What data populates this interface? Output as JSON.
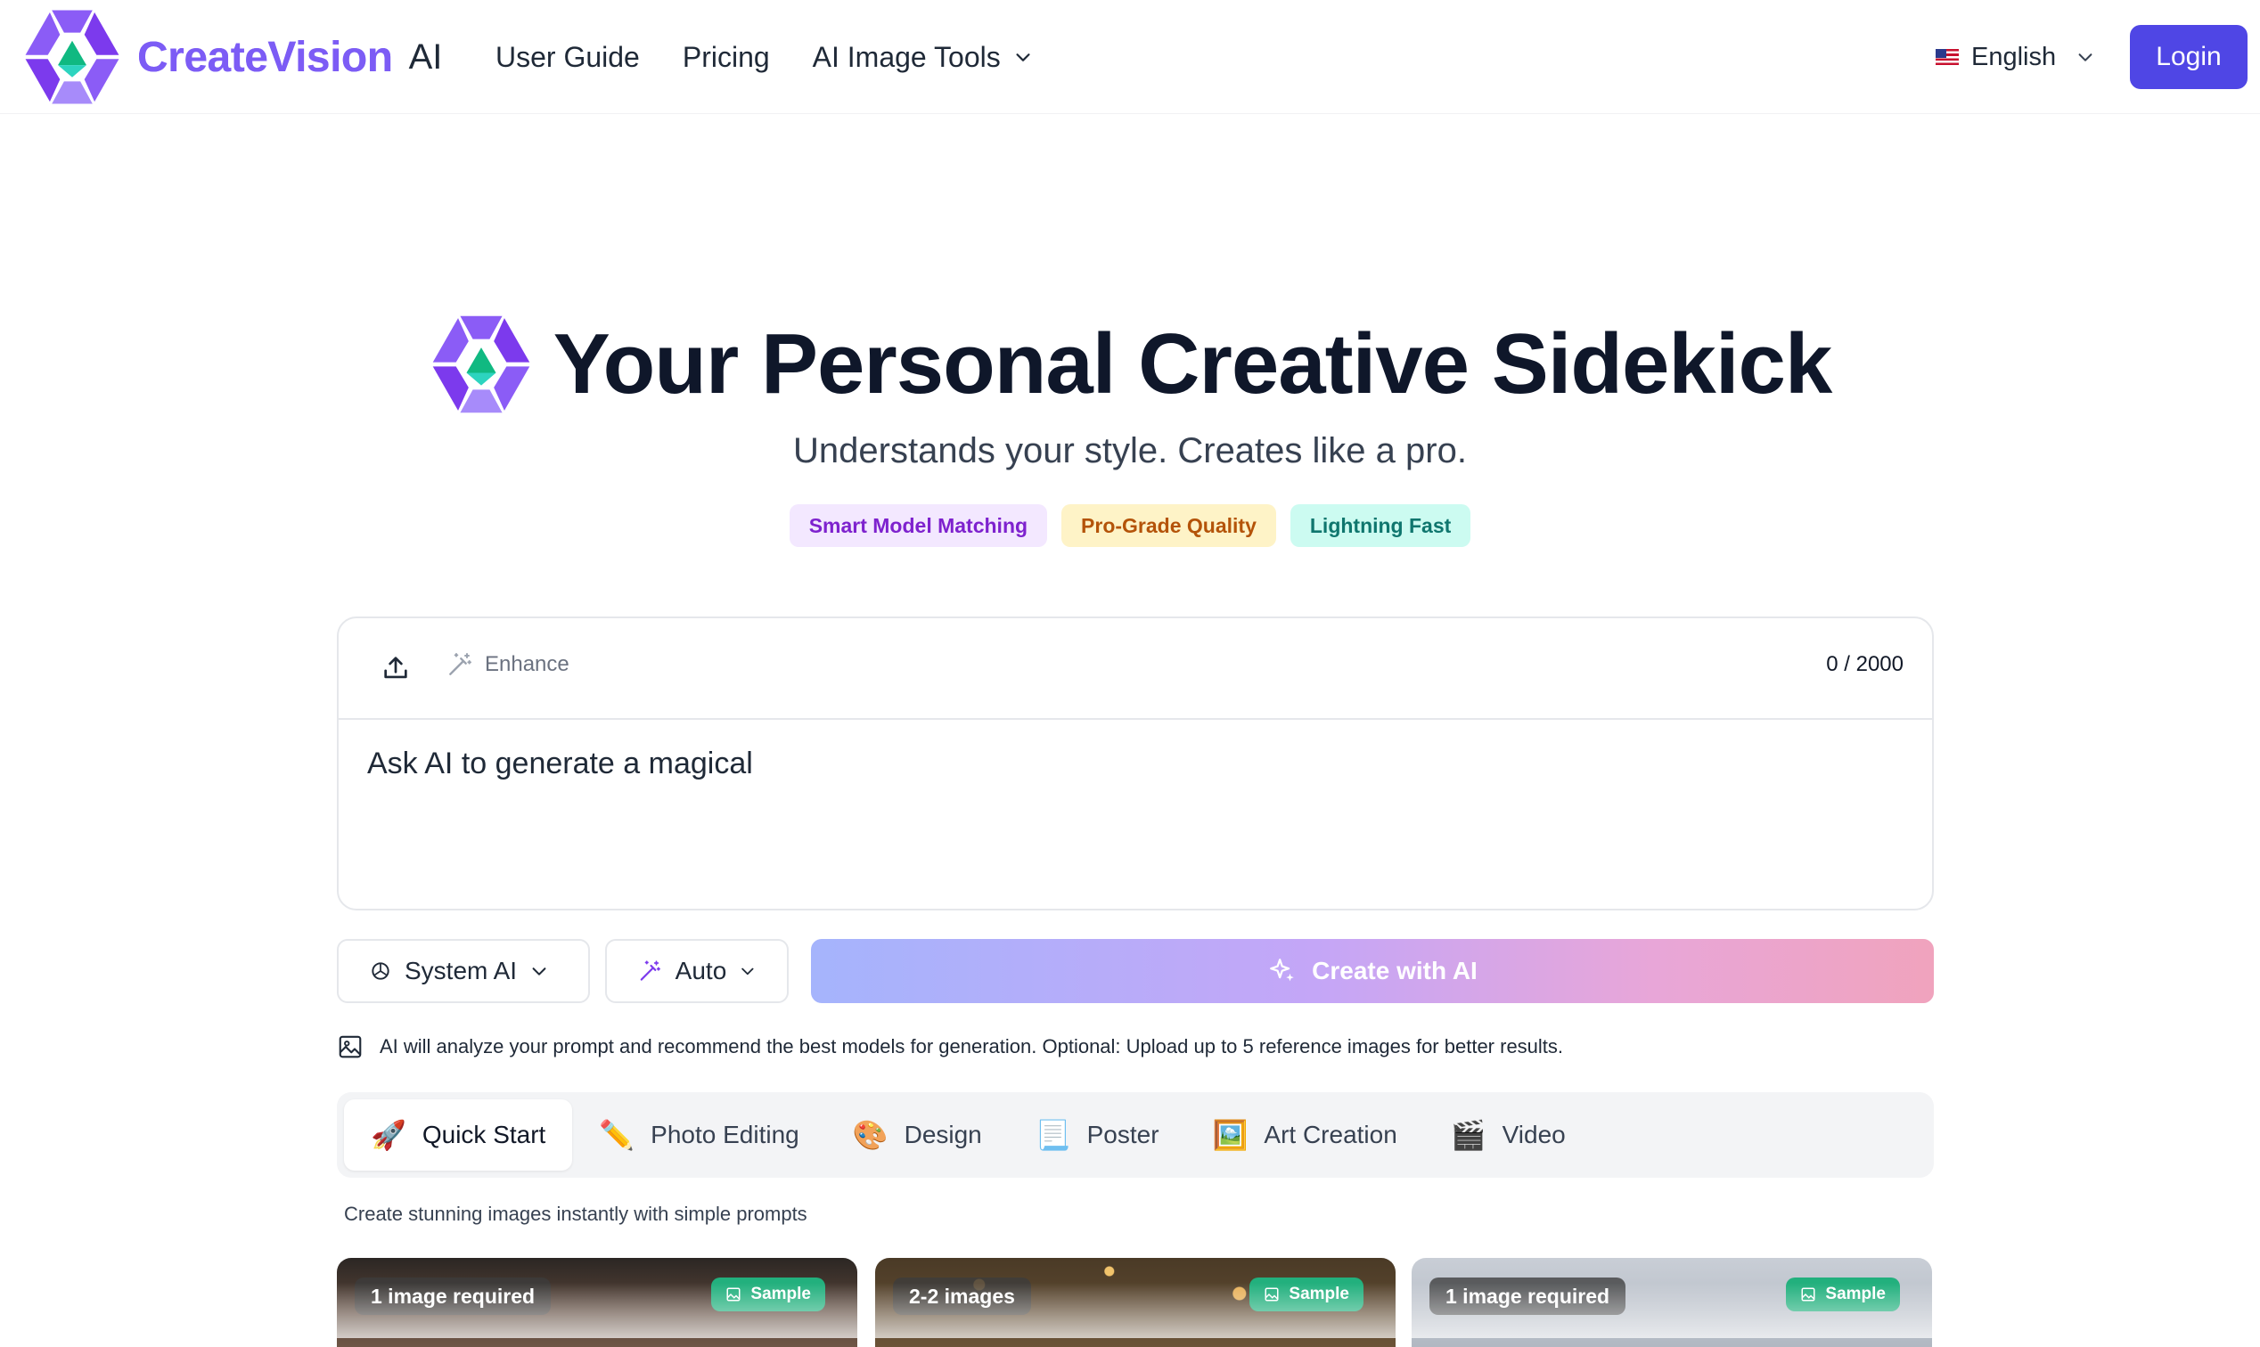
{
  "header": {
    "brand_name": "CreateVision",
    "brand_suffix": "AI",
    "nav": [
      {
        "label": "User Guide"
      },
      {
        "label": "Pricing"
      },
      {
        "label": "AI Image Tools"
      }
    ],
    "language": "English",
    "login_label": "Login"
  },
  "hero": {
    "title": "Your Personal Creative Sidekick",
    "subtitle": "Understands your style. Creates like a pro.",
    "badges": [
      "Smart Model Matching",
      "Pro-Grade Quality",
      "Lightning Fast"
    ]
  },
  "prompt": {
    "enhance_label": "Enhance",
    "counter": "0 / 2000",
    "text": "Ask AI to generate a magical"
  },
  "controls": {
    "model_select": "System AI",
    "mode_select": "Auto",
    "create_label": "Create with AI",
    "hint": "AI will analyze your prompt and recommend the best models for generation. Optional: Upload up to 5 reference images for better results."
  },
  "tabs": [
    {
      "emoji": "🚀",
      "label": "Quick Start",
      "active": true
    },
    {
      "emoji": "✏️",
      "label": "Photo Editing"
    },
    {
      "emoji": "🎨",
      "label": "Design"
    },
    {
      "emoji": "📃",
      "label": "Poster"
    },
    {
      "emoji": "🖼️",
      "label": "Art Creation"
    },
    {
      "emoji": "🎬",
      "label": "Video"
    }
  ],
  "tab_description": "Create stunning images instantly with simple prompts",
  "cards": [
    {
      "requirement": "1 image required",
      "tag": "Sample"
    },
    {
      "requirement": "2-2 images",
      "tag": "Sample"
    },
    {
      "requirement": "1 image required",
      "tag": "Sample"
    }
  ],
  "colors": {
    "accent": "#4f46e5",
    "brand": "#7c5cf5",
    "sample_badge": "#22b07d"
  }
}
